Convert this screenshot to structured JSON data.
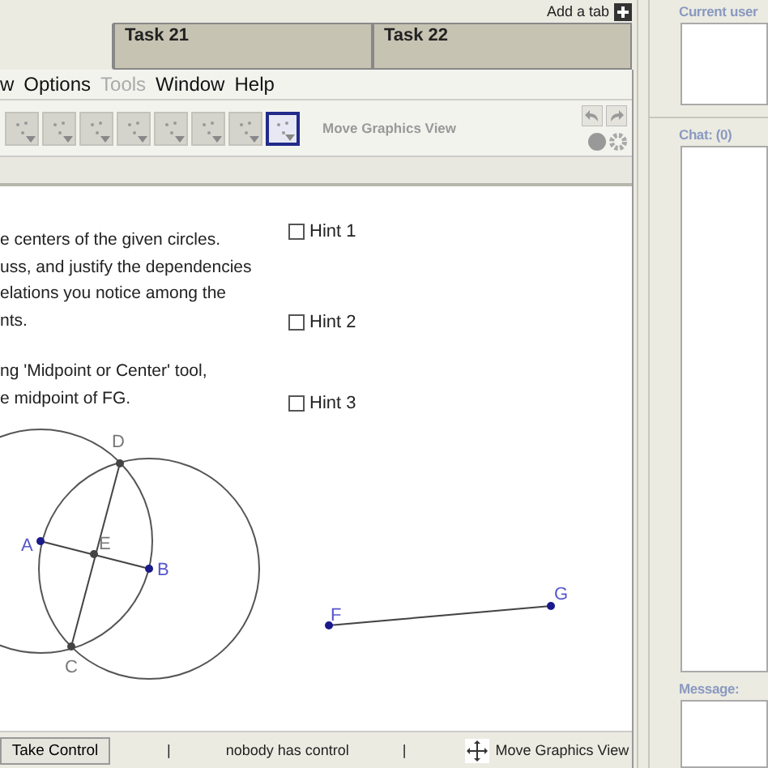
{
  "add_tab": {
    "label": "Add a tab"
  },
  "tabs": [
    {
      "selected": true
    },
    {
      "label": "Task 21",
      "selected": false
    },
    {
      "label": "Task 22",
      "selected": false
    }
  ],
  "menu": [
    {
      "label": "w",
      "disabled": false
    },
    {
      "label": "Options",
      "disabled": false
    },
    {
      "label": "Tools",
      "disabled": true
    },
    {
      "label": "Window",
      "disabled": false
    },
    {
      "label": "Help",
      "disabled": false
    }
  ],
  "toolbar": {
    "tools": [
      {
        "selected": false
      },
      {
        "selected": false
      },
      {
        "selected": false
      },
      {
        "selected": false
      },
      {
        "selected": false
      },
      {
        "selected": false
      },
      {
        "selected": false
      },
      {
        "selected": true
      }
    ],
    "tool_name": "Move Graphics View"
  },
  "instructions": [
    {
      "lines": [
        "e centers of the given circles.",
        "uss, and justify the dependencies",
        "elations you notice among the",
        "nts."
      ]
    },
    {
      "lines": [
        "ng 'Midpoint or Center' tool,",
        "e midpoint of FG."
      ]
    }
  ],
  "hints": [
    {
      "label": "Hint 1",
      "checked": false
    },
    {
      "label": "Hint 2",
      "checked": false
    },
    {
      "label": "Hint 3",
      "checked": false
    }
  ],
  "points": [
    {
      "label": "D",
      "kind": "dependent"
    },
    {
      "label": "A",
      "kind": "free"
    },
    {
      "label": "E",
      "kind": "dependent"
    },
    {
      "label": "B",
      "kind": "free"
    },
    {
      "label": "C",
      "kind": "dependent"
    },
    {
      "label": "F",
      "kind": "free"
    },
    {
      "label": "G",
      "kind": "free"
    }
  ],
  "status_bar": {
    "button": "Take Control",
    "separators": [
      "|",
      "|"
    ],
    "control_status": "nobody has control",
    "mode": "Move Graphics View"
  },
  "sidebar": {
    "users_label": "Current user",
    "chat_label": "Chat: (0)",
    "message_label": "Message:"
  }
}
